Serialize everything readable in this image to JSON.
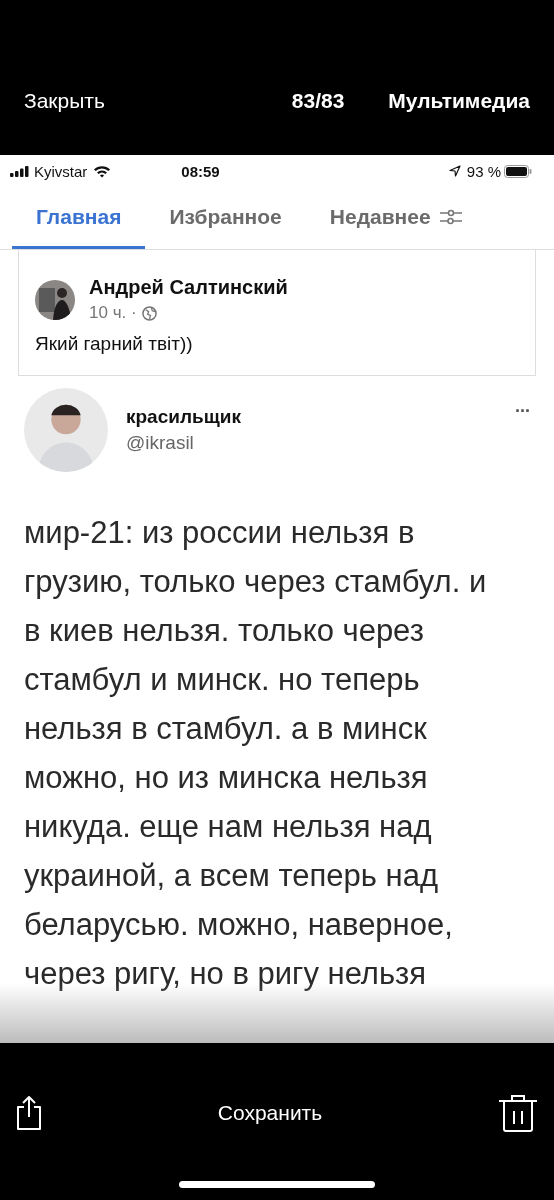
{
  "viewer": {
    "close": "Закрыть",
    "counter": "83/83",
    "title": "Мультимедиа"
  },
  "status_bar": {
    "carrier": "Kyivstar",
    "time": "08:59",
    "battery": "93 %"
  },
  "tabs": [
    {
      "label": "Главная",
      "selected": true
    },
    {
      "label": "Избранное",
      "selected": false
    },
    {
      "label": "Недавнее",
      "selected": false
    }
  ],
  "post": {
    "author": "Андрей Салтинский",
    "time": "10 ч. ·",
    "text": "Який гарний твіт))"
  },
  "tweet": {
    "name": "красильщик",
    "handle": "@ikrasil",
    "more": "...",
    "lines": [
      "мир-21: из россии нельзя в",
      "грузию, только через стамбул. и",
      "в киев нельзя. только через",
      "стамбул и минск. но теперь",
      "нельзя в стамбул. а в минск",
      "можно, но из минска нельзя",
      "никуда. еще нам нельзя над",
      "украиной, а всем теперь над",
      "беларусью. можно, наверное,",
      "через ригу, но в ригу нельзя"
    ]
  },
  "toolbar": {
    "save": "Сохранить"
  }
}
